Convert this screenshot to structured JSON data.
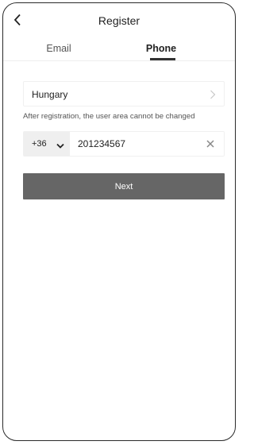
{
  "header": {
    "title": "Register",
    "back_icon": "chevron-left-icon"
  },
  "tabs": [
    {
      "label": "Email",
      "active": false
    },
    {
      "label": "Phone",
      "active": true
    }
  ],
  "region": {
    "country": "Hungary",
    "chevron_icon": "chevron-right-icon"
  },
  "hint": "After registration, the user area cannot be changed",
  "phone": {
    "country_code": "+36",
    "code_chevron_icon": "chevron-down-icon",
    "number": "201234567",
    "clear_icon": "close-icon"
  },
  "next_button": {
    "label": "Next",
    "color": "#666666"
  }
}
